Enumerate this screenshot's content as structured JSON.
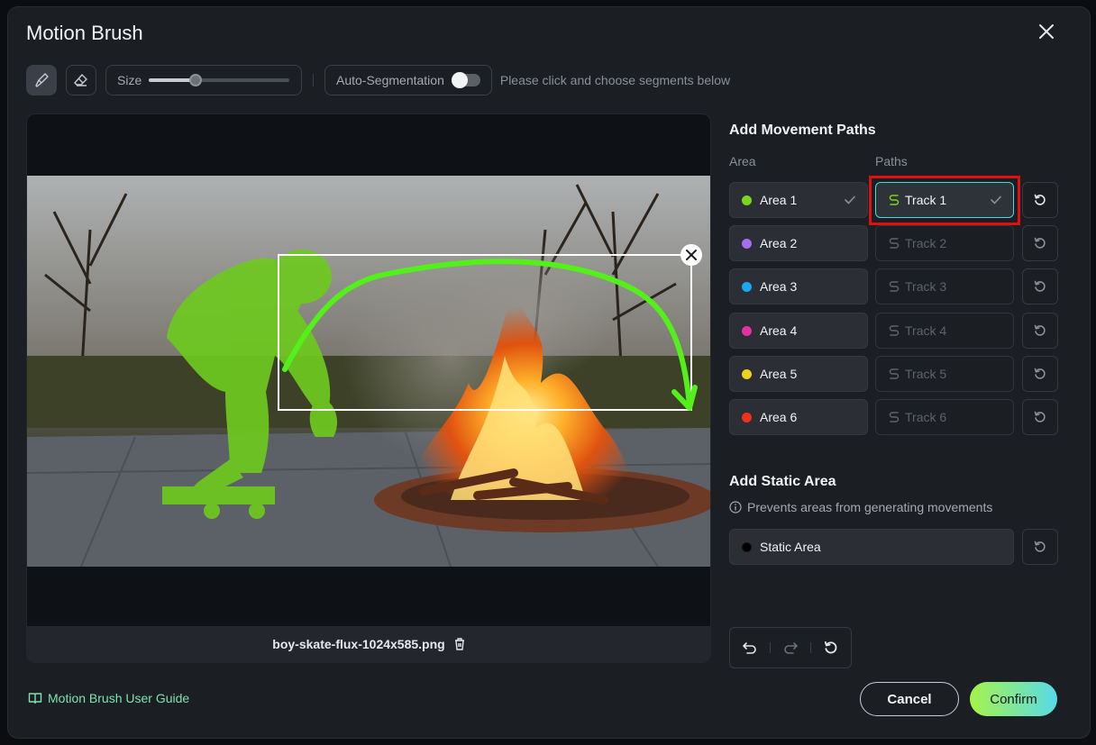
{
  "dialog": {
    "title": "Motion Brush"
  },
  "toolbar": {
    "size_label": "Size",
    "size_value": 0.33,
    "auto_seg_label": "Auto-Segmentation",
    "auto_seg_on": false,
    "hint": "Please click and choose segments below"
  },
  "canvas": {
    "filename": "boy-skate-flux-1024x585.png"
  },
  "movement": {
    "title": "Add Movement Paths",
    "area_col": "Area",
    "paths_col": "Paths",
    "rows": [
      {
        "area": "Area 1",
        "color": "#7ad61c",
        "track": "Track 1",
        "area_done": true,
        "track_active": true
      },
      {
        "area": "Area 2",
        "color": "#a56ef0",
        "track": "Track 2"
      },
      {
        "area": "Area 3",
        "color": "#1aa8f0",
        "track": "Track 3"
      },
      {
        "area": "Area 4",
        "color": "#e62fa0",
        "track": "Track 4"
      },
      {
        "area": "Area 5",
        "color": "#f0d21a",
        "track": "Track 5"
      },
      {
        "area": "Area 6",
        "color": "#f0321a",
        "track": "Track 6"
      }
    ]
  },
  "static": {
    "title": "Add Static Area",
    "note": "Prevents areas from generating movements",
    "label": "Static Area",
    "color": "#000000"
  },
  "footer": {
    "guide": "Motion Brush User Guide",
    "cancel": "Cancel",
    "confirm": "Confirm"
  }
}
